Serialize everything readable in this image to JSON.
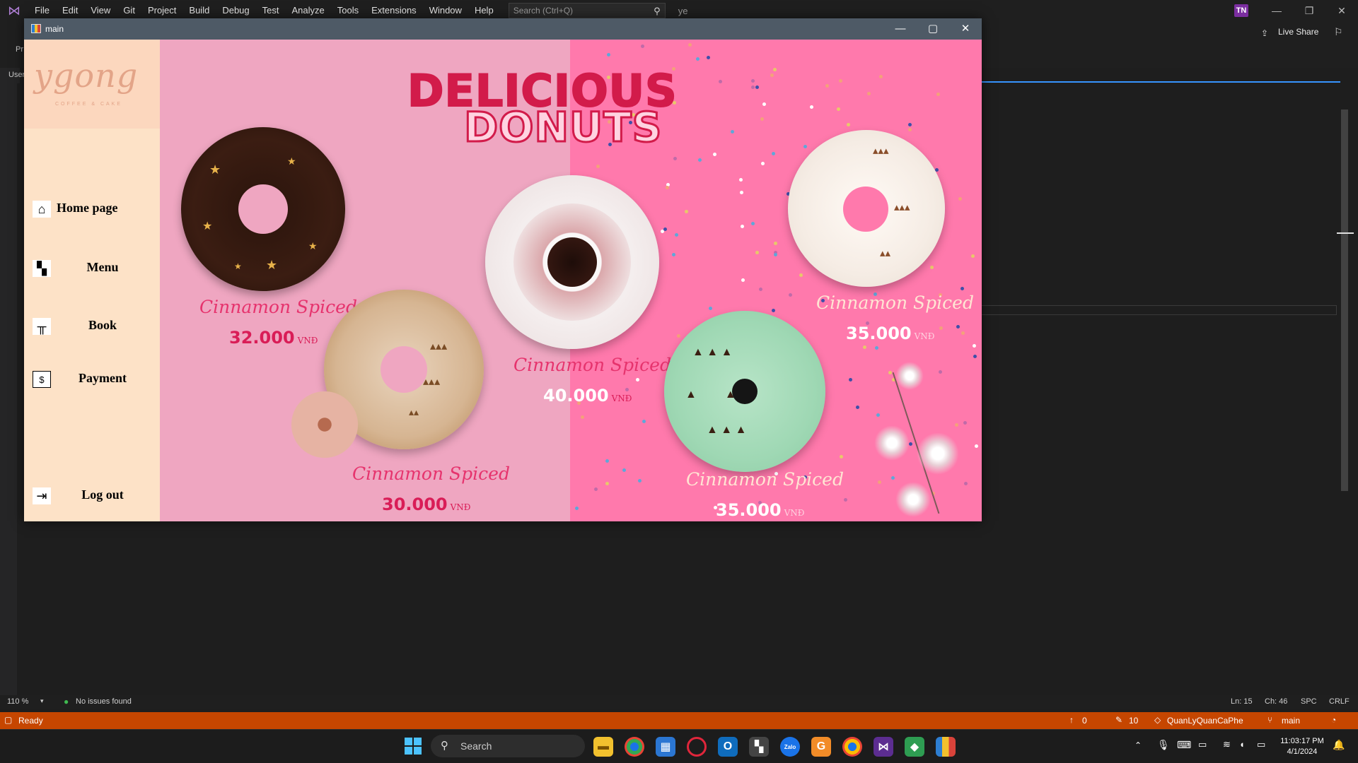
{
  "vs": {
    "menu": [
      "File",
      "Edit",
      "View",
      "Git",
      "Project",
      "Build",
      "Debug",
      "Test",
      "Analyze",
      "Tools",
      "Extensions",
      "Window",
      "Help"
    ],
    "search_placeholder": "Search (Ctrl+Q)",
    "solution_name": "ye",
    "avatar": "TN",
    "live_share": "Live Share",
    "gutter_text_1": "Pr",
    "gutter_text_2": "User"
  },
  "info_bar": {
    "zoom": "110 %",
    "issues": "No issues found",
    "ln": "Ln: 15",
    "ch": "Ch: 46",
    "spc": "SPC",
    "crlf": "CRLF"
  },
  "status_bar": {
    "state": "Ready",
    "up_count": "0",
    "pencil_count": "10",
    "repo": "QuanLyQuanCaPhe",
    "branch": "main"
  },
  "taskbar": {
    "search_label": "Search",
    "time": "11:03:17 PM",
    "date": "4/1/2024"
  },
  "app": {
    "title": "main",
    "logo_script": "ygong",
    "logo_sub": "COFFEE & CAKE",
    "nav": [
      {
        "label": "Home page",
        "icon": "home-icon"
      },
      {
        "label": "Menu",
        "icon": "menu-grid-icon"
      },
      {
        "label": "Book",
        "icon": "table-icon"
      },
      {
        "label": "Payment",
        "icon": "dollar-icon"
      },
      {
        "label": "Log out",
        "icon": "logout-icon"
      }
    ],
    "headline_1": "DELICIOUS",
    "headline_2": "DONUTS",
    "products": [
      {
        "name": "Cinnamon Spiced",
        "price": "32.000",
        "currency": "VNĐ"
      },
      {
        "name": "Cinnamon Spiced",
        "price": "30.000",
        "currency": "VNĐ"
      },
      {
        "name": "Cinnamon Spiced",
        "price": "40.000",
        "currency": "VNĐ"
      },
      {
        "name": "Cinnamon Spiced",
        "price": "35.000",
        "currency": "VNĐ"
      },
      {
        "name": "Cinnamon Spiced",
        "price": "35.000",
        "currency": "VNĐ"
      }
    ]
  },
  "colors": {
    "vs_status": "#c64600",
    "sidebar": "#fde2c7",
    "left_bg": "#efa6c1",
    "right_bg": "#ff79ac",
    "headline": "#d21b4a"
  }
}
